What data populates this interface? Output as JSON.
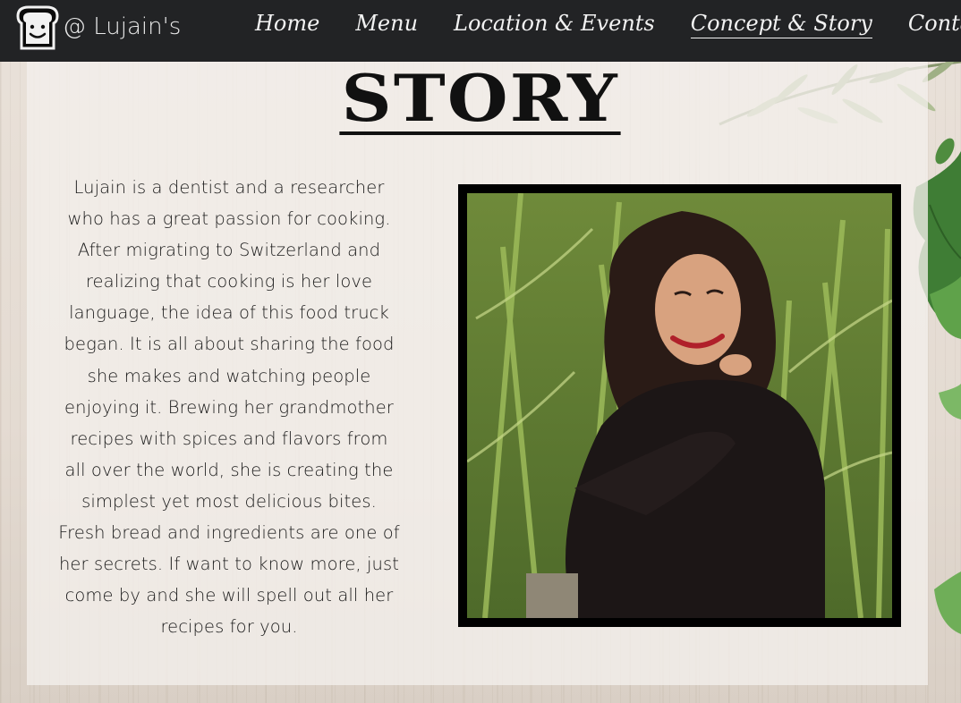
{
  "nav": {
    "brand_name": "@ Lujain's",
    "logo_icon": "smiling-bread-icon",
    "links": [
      {
        "label": "Home"
      },
      {
        "label": "Menu"
      },
      {
        "label": "Location & Events"
      },
      {
        "label": "Concept & Story",
        "active": true
      },
      {
        "label": "Contact"
      }
    ]
  },
  "page": {
    "title": "STORY",
    "story": "Lujain is a dentist and a researcher who has a great passion for cooking. After migrating to Switzerland and realizing that cooking is her love language, the idea of this food truck began. It is all about sharing the food she makes and watching people enjoying it. Brewing her grandmother recipes with spices and flavors from all over the world, she is creating the simplest yet most delicious bites. Fresh bread and ingredients are one of her secrets. If want to know more, just come by and she will spell out all her recipes for you.",
    "photo_subject": "portrait-photo"
  },
  "colors": {
    "navbar_bg": "#222325",
    "nav_text": "#f2f2f2",
    "frame": "#000000",
    "panel": "#f4f0ec"
  }
}
